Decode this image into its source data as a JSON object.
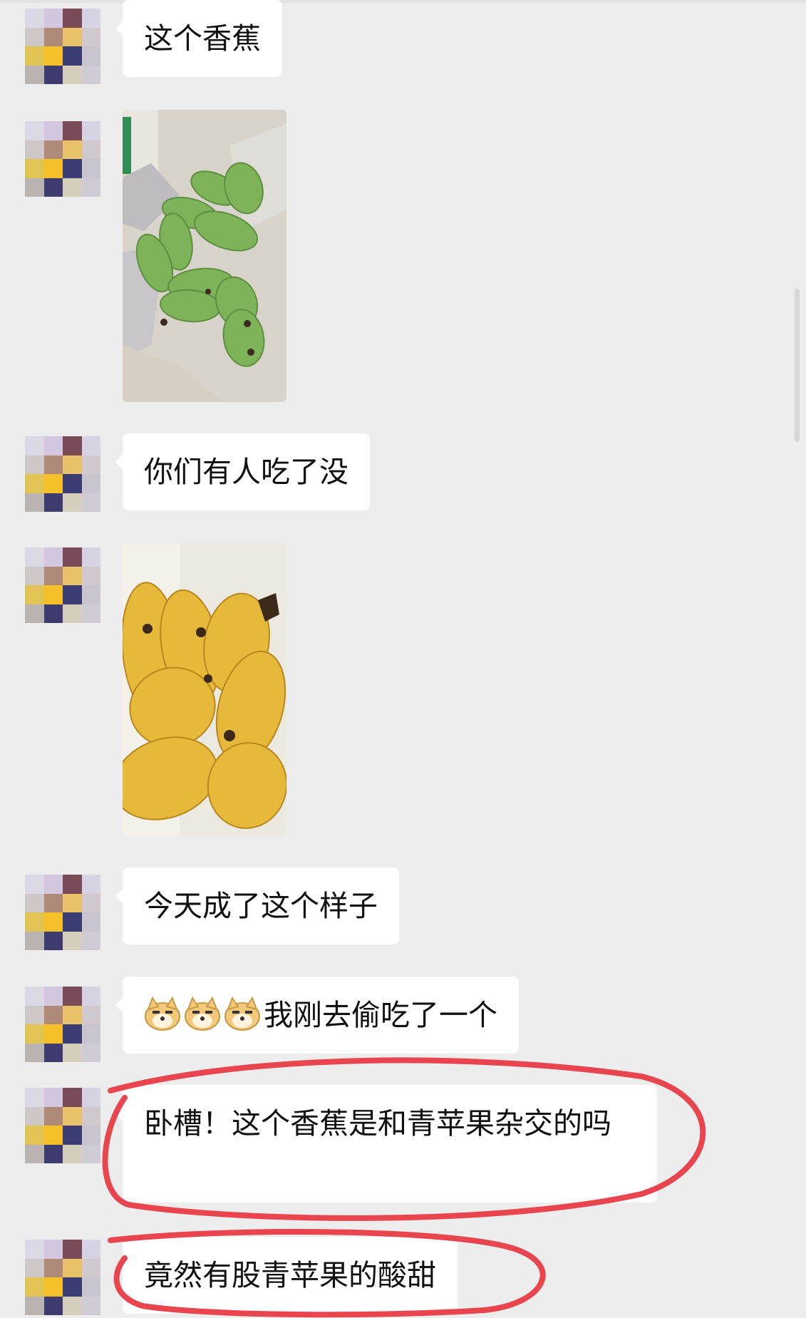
{
  "messages": [
    {
      "type": "text",
      "text": "这个香蕉"
    },
    {
      "type": "image",
      "alt": "green bananas photo"
    },
    {
      "type": "text",
      "text": "你们有人吃了没"
    },
    {
      "type": "image",
      "alt": "yellow bananas photo"
    },
    {
      "type": "text",
      "text": "今天成了这个样子"
    },
    {
      "type": "text",
      "emoji": [
        "doge-emoji",
        "doge-emoji",
        "doge-emoji"
      ],
      "text": "我刚去偷吃了一个"
    },
    {
      "type": "text",
      "text": "卧槽！这个香蕉是和青苹果杂交的吗"
    },
    {
      "type": "text",
      "text": "竟然有股青苹果的酸甜"
    }
  ],
  "colors": {
    "background": "#ededed",
    "bubble": "#ffffff",
    "highlight_circle": "#e8454f"
  }
}
